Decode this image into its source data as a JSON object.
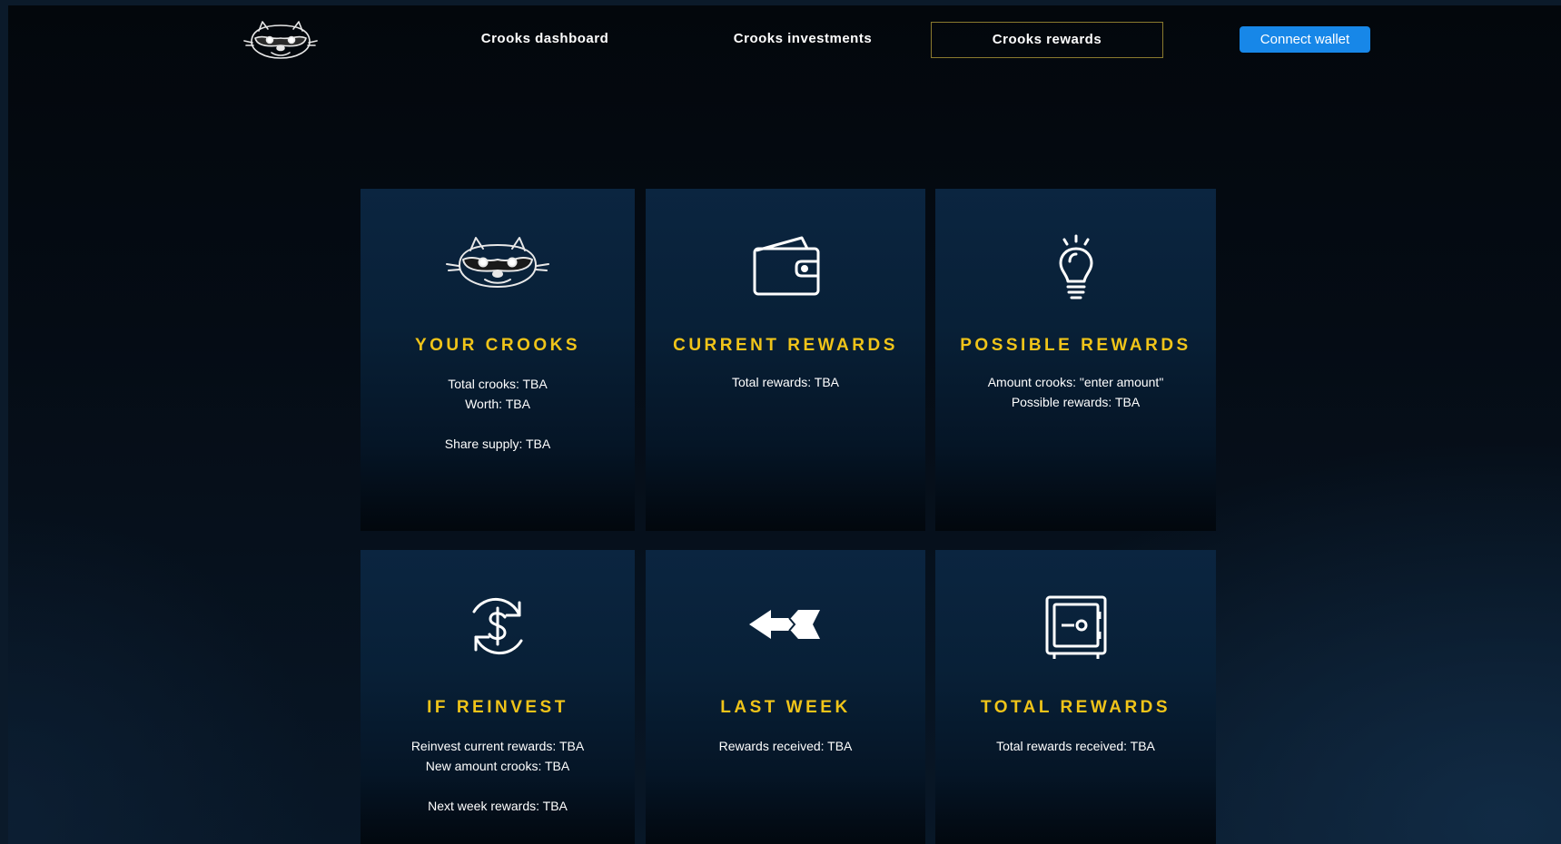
{
  "nav": {
    "logo_icon": "raccoon-mascot-icon",
    "links": [
      "Crooks dashboard",
      "Crooks investments",
      "Crooks rewards"
    ],
    "active": "Crooks rewards",
    "connect_label": "Connect wallet"
  },
  "colors": {
    "accent": "#1787e8",
    "title_yellow": "#f0c419",
    "active_border": "#8a7a2e",
    "card_top": "#0b2540",
    "page_bg": "#050c15"
  },
  "cards": [
    {
      "icon": "raccoon-icon",
      "title": "YOUR CROOKS",
      "lines": [
        "Total crooks: TBA",
        "Worth: TBA",
        "Share supply: TBA"
      ]
    },
    {
      "icon": "wallet-icon",
      "title": "CURRENT REWARDS",
      "lines": [
        "Total rewards: TBA"
      ]
    },
    {
      "icon": "lightbulb-icon",
      "title": "POSSIBLE REWARDS",
      "lines": [
        "Amount crooks: \"enter amount\"",
        "Possible rewards: TBA"
      ]
    },
    {
      "icon": "dollar-refresh-icon",
      "title": "IF REINVEST",
      "lines": [
        "Reinvest current rewards: TBA",
        "New amount crooks: TBA",
        "Next week rewards: TBA"
      ]
    },
    {
      "icon": "arrow-left-icon",
      "title": "LAST WEEK",
      "lines": [
        "Rewards received: TBA"
      ]
    },
    {
      "icon": "safe-icon",
      "title": "TOTAL REWARDS",
      "lines": [
        "Total rewards received: TBA"
      ]
    }
  ]
}
